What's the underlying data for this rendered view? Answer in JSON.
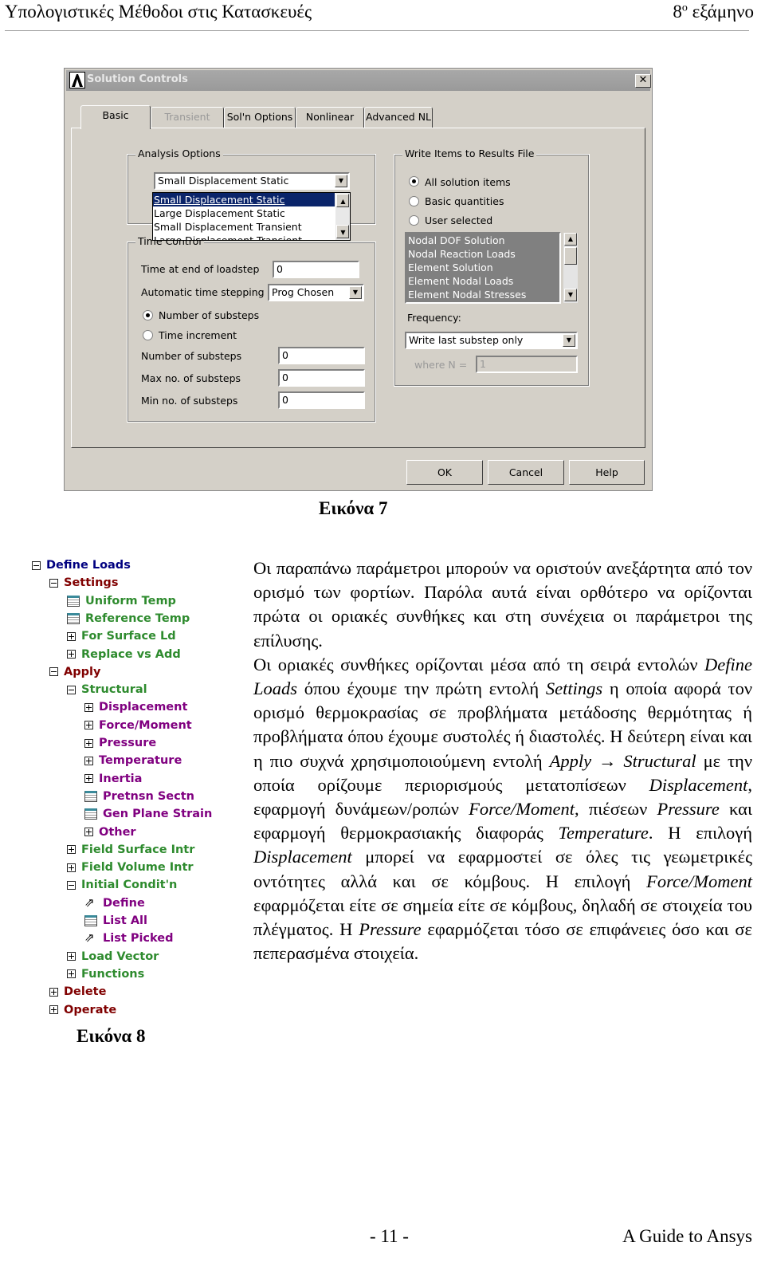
{
  "header": {
    "left": "Υπολογιστικές Μέθοδοι στις Κατασκευές",
    "right_num": "8",
    "right_sup": "ο",
    "right_text": " εξάμηνο"
  },
  "figure7": {
    "caption": "Εικόνα 7",
    "title": "Solution Controls",
    "close": "✕",
    "tabs": [
      {
        "label": "Basic",
        "active": true
      },
      {
        "label": "Transient",
        "disabled": true
      },
      {
        "label": "Sol'n Options"
      },
      {
        "label": "Nonlinear"
      },
      {
        "label": "Advanced NL"
      }
    ],
    "analysis": {
      "legend": "Analysis Options",
      "combo_value": "Small Displacement Static",
      "options": [
        "Small Displacement Static",
        "Large Displacement Static",
        "Small Displacement Transient",
        "Large Displacement Transient"
      ]
    },
    "time": {
      "legend": "Time Control",
      "end_label": "Time at end of loadstep",
      "end_value": "0",
      "auto_label": "Automatic time stepping",
      "auto_value": "Prog Chosen",
      "radio_substeps": "Number of substeps",
      "radio_increment": "Time increment",
      "num_label": "Number of substeps",
      "num_value": "0",
      "max_label": "Max no. of substeps",
      "max_value": "0",
      "min_label": "Min no. of substeps",
      "min_value": "0"
    },
    "write": {
      "legend": "Write Items to Results File",
      "radio_all": "All solution items",
      "radio_basic": "Basic quantities",
      "radio_user": "User selected",
      "items": [
        "Nodal DOF Solution",
        "Nodal Reaction Loads",
        "Element Solution",
        "Element Nodal Loads",
        "Element Nodal Stresses"
      ],
      "freq_label": "Frequency:",
      "freq_value": "Write last substep only",
      "where_label": "where N =",
      "where_value": "1"
    },
    "buttons": {
      "ok": "OK",
      "cancel": "Cancel",
      "help": "Help"
    }
  },
  "figure8": {
    "caption": "Εικόνα 8",
    "colors": {
      "root": "#000080",
      "section": "#800000",
      "group": "#2e8b2e",
      "leaf": "#800080"
    },
    "tree": [
      {
        "label": "Define Loads",
        "level": 0,
        "icon": "minus",
        "kind": "root"
      },
      {
        "label": "Settings",
        "level": 1,
        "icon": "minus",
        "kind": "section"
      },
      {
        "label": "Uniform Temp",
        "level": 2,
        "icon": "table",
        "kind": "group"
      },
      {
        "label": "Reference Temp",
        "level": 2,
        "icon": "table",
        "kind": "group"
      },
      {
        "label": "For Surface Ld",
        "level": 2,
        "icon": "plus",
        "kind": "group"
      },
      {
        "label": "Replace vs Add",
        "level": 2,
        "icon": "plus",
        "kind": "group"
      },
      {
        "label": "Apply",
        "level": 1,
        "icon": "minus",
        "kind": "section"
      },
      {
        "label": "Structural",
        "level": 2,
        "icon": "minus",
        "kind": "group"
      },
      {
        "label": "Displacement",
        "level": 3,
        "icon": "plus",
        "kind": "leaf"
      },
      {
        "label": "Force/Moment",
        "level": 3,
        "icon": "plus",
        "kind": "leaf"
      },
      {
        "label": "Pressure",
        "level": 3,
        "icon": "plus",
        "kind": "leaf"
      },
      {
        "label": "Temperature",
        "level": 3,
        "icon": "plus",
        "kind": "leaf"
      },
      {
        "label": "Inertia",
        "level": 3,
        "icon": "plus",
        "kind": "leaf"
      },
      {
        "label": "Pretnsn Sectn",
        "level": 3,
        "icon": "table",
        "kind": "leaf"
      },
      {
        "label": "Gen Plane Strain",
        "level": 3,
        "icon": "table",
        "kind": "leaf"
      },
      {
        "label": "Other",
        "level": 3,
        "icon": "plus",
        "kind": "leaf"
      },
      {
        "label": "Field Surface Intr",
        "level": 2,
        "icon": "plus",
        "kind": "group"
      },
      {
        "label": "Field Volume Intr",
        "level": 2,
        "icon": "plus",
        "kind": "group"
      },
      {
        "label": "Initial Condit'n",
        "level": 2,
        "icon": "minus",
        "kind": "group"
      },
      {
        "label": "Define",
        "level": 3,
        "icon": "pick",
        "kind": "leaf"
      },
      {
        "label": "List All",
        "level": 3,
        "icon": "table",
        "kind": "leaf"
      },
      {
        "label": "List Picked",
        "level": 3,
        "icon": "pick",
        "kind": "leaf"
      },
      {
        "label": "Load Vector",
        "level": 2,
        "icon": "plus",
        "kind": "group"
      },
      {
        "label": "Functions",
        "level": 2,
        "icon": "plus",
        "kind": "group"
      },
      {
        "label": "Delete",
        "level": 1,
        "icon": "plus",
        "kind": "section"
      },
      {
        "label": "Operate",
        "level": 1,
        "icon": "plus",
        "kind": "section"
      }
    ]
  },
  "body": {
    "paragraphs": [
      [
        {
          "t": "Οι παραπάνω παράμετροι μπορούν να οριστούν ανεξάρτητα από τον ορισμό των φορτίων. Παρόλα αυτά είναι ορθότερο να ορίζονται πρώτα οι οριακές συνθήκες και στη συνέχεια οι παράμετροι της επίλυσης."
        }
      ],
      [
        {
          "t": " Οι οριακές συνθήκες ορίζονται μέσα από τη σειρά εντολών "
        },
        {
          "t": "Define Loads",
          "i": true
        },
        {
          "t": " όπου έχουμε την πρώτη εντολή "
        },
        {
          "t": "Settings",
          "i": true
        },
        {
          "t": " η οποία αφορά τον ορισμό θερμοκρασίας σε προβλήματα μετάδοσης θερμότητας ή προβλήματα όπου έχουμε συστολές ή διαστολές. Η δεύτερη είναι και η πιο συχνά χρησιμοποιούμενη εντολή "
        },
        {
          "t": "Apply",
          "i": true
        },
        {
          "t": " → "
        },
        {
          "t": "Structural",
          "i": true
        },
        {
          "t": " με την οποία ορίζουμε περιορισμούς μετατοπίσεων "
        },
        {
          "t": "Displacement",
          "i": true
        },
        {
          "t": ", εφαρμογή δυνάμεων/ροπών "
        },
        {
          "t": "Force/Moment",
          "i": true
        },
        {
          "t": ", πιέσεων "
        },
        {
          "t": "Pressure",
          "i": true
        },
        {
          "t": " και εφαρμογή θερμοκρασιακής διαφοράς "
        },
        {
          "t": "Temperature",
          "i": true
        },
        {
          "t": ". Η επιλογή "
        },
        {
          "t": "Displacement",
          "i": true
        },
        {
          "t": " μπορεί να εφαρμοστεί σε όλες τις γεωμετρικές οντότητες αλλά και σε κόμβους. Η επιλογή "
        },
        {
          "t": "Force/Moment",
          "i": true
        },
        {
          "t": " εφαρμόζεται είτε σε σημεία είτε σε κόμβους, δηλαδή σε στοιχεία του πλέγματος. Η "
        },
        {
          "t": "Pressure",
          "i": true
        },
        {
          "t": " εφαρμόζεται τόσο σε επιφάνειες όσο και σε πεπερασμένα στοιχεία."
        }
      ]
    ]
  },
  "footer": {
    "page": "- 11 -",
    "title": "A Guide to Ansys"
  }
}
